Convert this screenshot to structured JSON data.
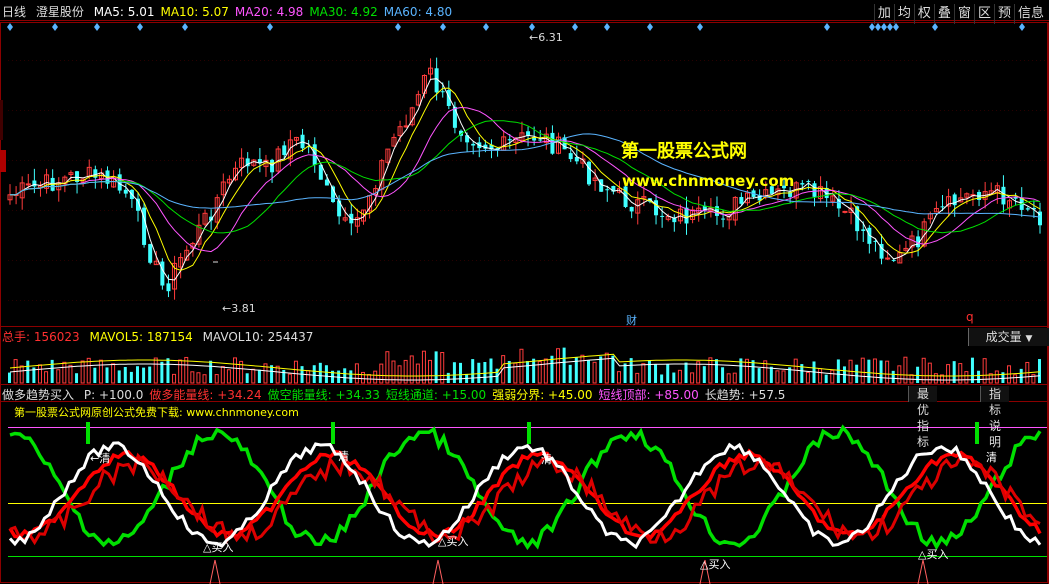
{
  "header": {
    "period": "日线",
    "stock_name": "澄星股份",
    "ma": [
      {
        "label": "MA5: 5.01",
        "color": "#ffffff"
      },
      {
        "label": "MA10: 5.07",
        "color": "#ffff00"
      },
      {
        "label": "MA20: 4.98",
        "color": "#ff55ff"
      },
      {
        "label": "MA30: 4.92",
        "color": "#00e000"
      },
      {
        "label": "MA60: 4.80",
        "color": "#5ab4ff"
      }
    ]
  },
  "toolbar": {
    "items": [
      "加",
      "均",
      "权",
      "叠",
      "窗",
      "区",
      "预",
      "信息"
    ]
  },
  "price_panel": {
    "high_label": "6.31",
    "low_label": "3.81",
    "marker_cai": "财",
    "marker_q": "q",
    "watermark_title": "第一股票公式网",
    "watermark_url": "www.chnmoney.com"
  },
  "volume_panel": {
    "total_label": "总手: 156023",
    "mavol5": "MAVOL5: 187154",
    "mavol10": "MAVOL10: 254437",
    "dropdown": "成交量"
  },
  "indicator_panel": {
    "title": "做多趋势买入",
    "params": [
      {
        "label": "P: +100.0",
        "color": "#dddddd"
      },
      {
        "label": "做多能量线: +34.24",
        "color": "#ff3030"
      },
      {
        "label": "做空能量线: +34.33",
        "color": "#00e000"
      },
      {
        "label": "短线通道: +15.00",
        "color": "#00e000"
      },
      {
        "label": "强弱分界: +45.00",
        "color": "#ffff00"
      },
      {
        "label": "短线顶部: +85.00",
        "color": "#ff55ff"
      },
      {
        "label": "长趋势: +57.5",
        "color": "#dddddd"
      }
    ],
    "buttons": [
      "最优指标",
      "指标说明"
    ],
    "subtitle": "第一股票公式网原创公式免费下载: www.chnmoney.com",
    "sell_label": "清",
    "buy_label": "买入",
    "sell_arrow_label": "←清"
  },
  "colors": {
    "up": "#ff3c3c",
    "down": "#40ffff",
    "bg": "#000000",
    "grid": "#8b0000",
    "red_line": "#ff0000",
    "green_line": "#00e000",
    "white_line": "#ffffff"
  }
}
